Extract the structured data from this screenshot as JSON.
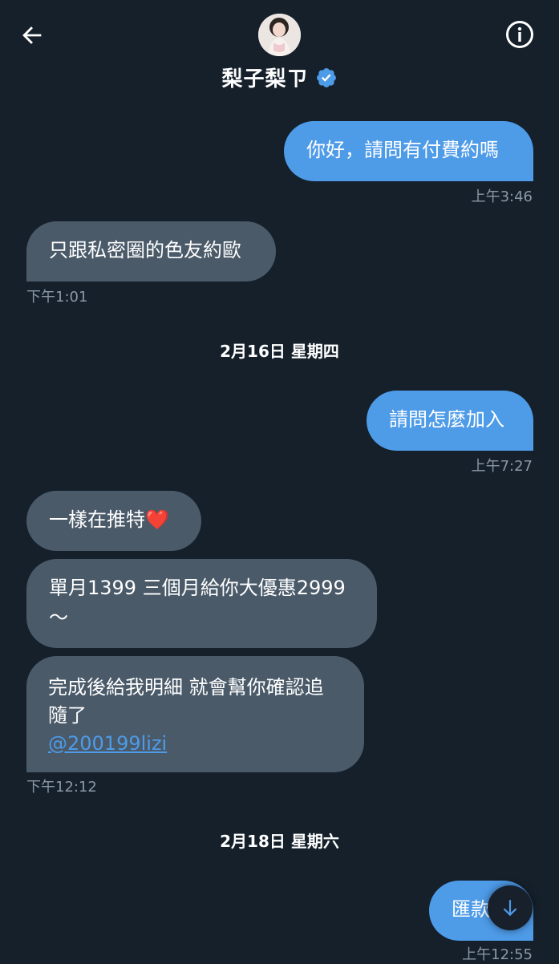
{
  "header": {
    "contact_name": "梨子梨ㄗ",
    "back_icon": "arrow-left-icon",
    "info_icon": "info-icon",
    "verified_icon": "verified-badge-icon",
    "verified_color": "#4e9be8"
  },
  "messages": [
    {
      "direction": "outgoing",
      "text": "你好，請問有付費約嗎",
      "time": "上午3:46"
    },
    {
      "direction": "incoming",
      "text": "只跟私密圈的色友約歐",
      "time": "下午1:01"
    },
    {
      "type": "date",
      "text": "2月16日 星期四"
    },
    {
      "direction": "outgoing",
      "text": "請問怎麼加入",
      "time": "上午7:27"
    },
    {
      "direction": "incoming",
      "text": "一樣在推特",
      "emoji": "❤️"
    },
    {
      "direction": "incoming",
      "line1": "單月1399 三個月給你大優惠2999",
      "line2": "～"
    },
    {
      "direction": "incoming",
      "line1": "完成後給我明細 就會幫你確認追",
      "line2": "隨了",
      "mention": "@200199lizi",
      "time": "下午12:12"
    },
    {
      "type": "date",
      "text": "2月18日 星期六"
    },
    {
      "direction": "outgoing",
      "text": "匯款",
      "time": "上午12:55"
    }
  ],
  "scroll_button": {
    "icon": "arrow-down-icon"
  },
  "colors": {
    "background": "#15202b",
    "outgoing_bubble": "#4e9be8",
    "incoming_bubble": "#4a5a69",
    "timestamp": "#8b98a5"
  }
}
